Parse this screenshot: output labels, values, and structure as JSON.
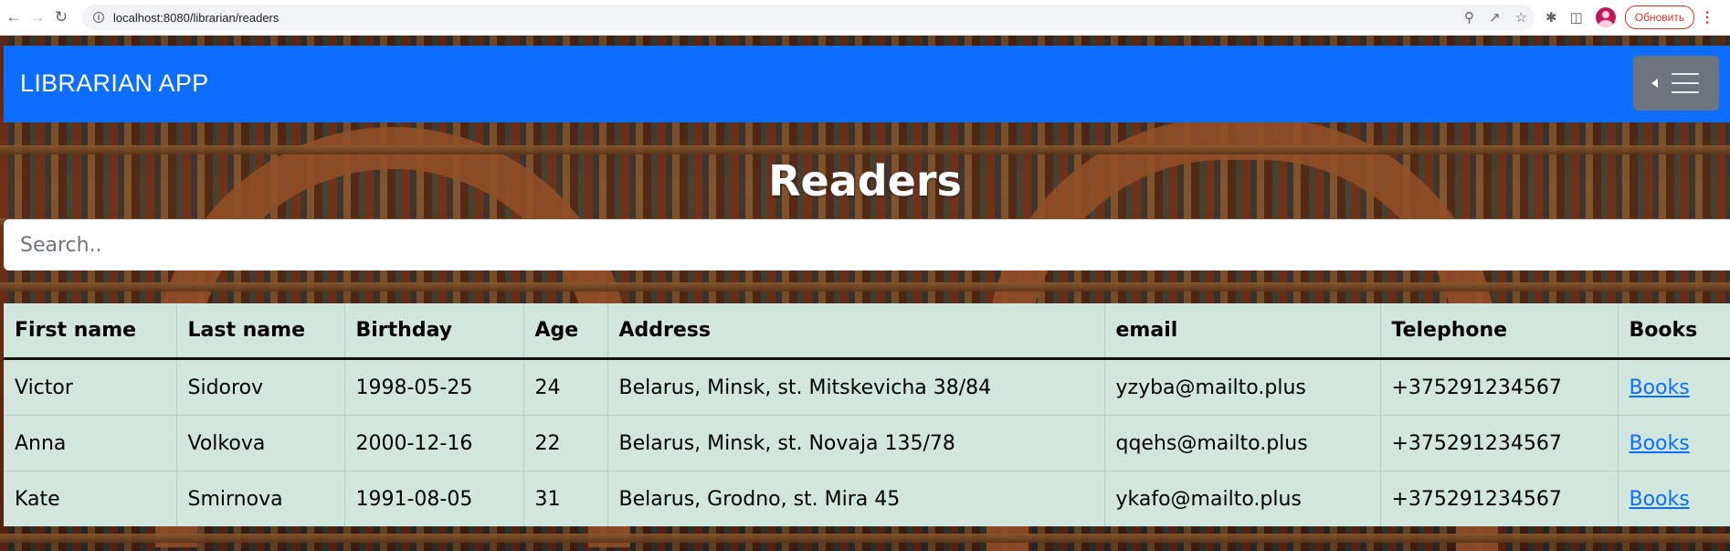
{
  "browser": {
    "url": "localhost:8080/librarian/readers",
    "update_label": "Обновить"
  },
  "navbar": {
    "brand": "LIBRARIAN APP"
  },
  "page": {
    "title": "Readers"
  },
  "search": {
    "placeholder": "Search.."
  },
  "table": {
    "headers": [
      "First name",
      "Last name",
      "Birthday",
      "Age",
      "Address",
      "email",
      "Telephone",
      "Books"
    ],
    "rows": [
      {
        "first_name": "Victor",
        "last_name": "Sidorov",
        "birthday": "1998-05-25",
        "age": "24",
        "address": "Belarus, Minsk, st. Mitskevicha 38/84",
        "email": "yzyba@mailto.plus",
        "telephone": "+375291234567",
        "books": "Books"
      },
      {
        "first_name": "Anna",
        "last_name": "Volkova",
        "birthday": "2000-12-16",
        "age": "22",
        "address": "Belarus, Minsk, st. Novaja 135/78",
        "email": "qqehs@mailto.plus",
        "telephone": "+375291234567",
        "books": "Books"
      },
      {
        "first_name": "Kate",
        "last_name": "Smirnova",
        "birthday": "1991-08-05",
        "age": "31",
        "address": "Belarus, Grodno, st. Mira 45",
        "email": "ykafo@mailto.plus",
        "telephone": "+375291234567",
        "books": "Books"
      }
    ]
  },
  "colors": {
    "navbar": "#0d6efd",
    "table_row": "#d1e7dd",
    "toggler": "#6c757d",
    "link": "#0d6efd"
  },
  "icons": [
    "back-arrow-icon",
    "forward-arrow-icon",
    "reload-icon",
    "info-icon",
    "zoom-icon",
    "share-icon",
    "star-icon",
    "extensions-icon",
    "sidebar-icon",
    "profile-avatar",
    "menu-icon"
  ]
}
